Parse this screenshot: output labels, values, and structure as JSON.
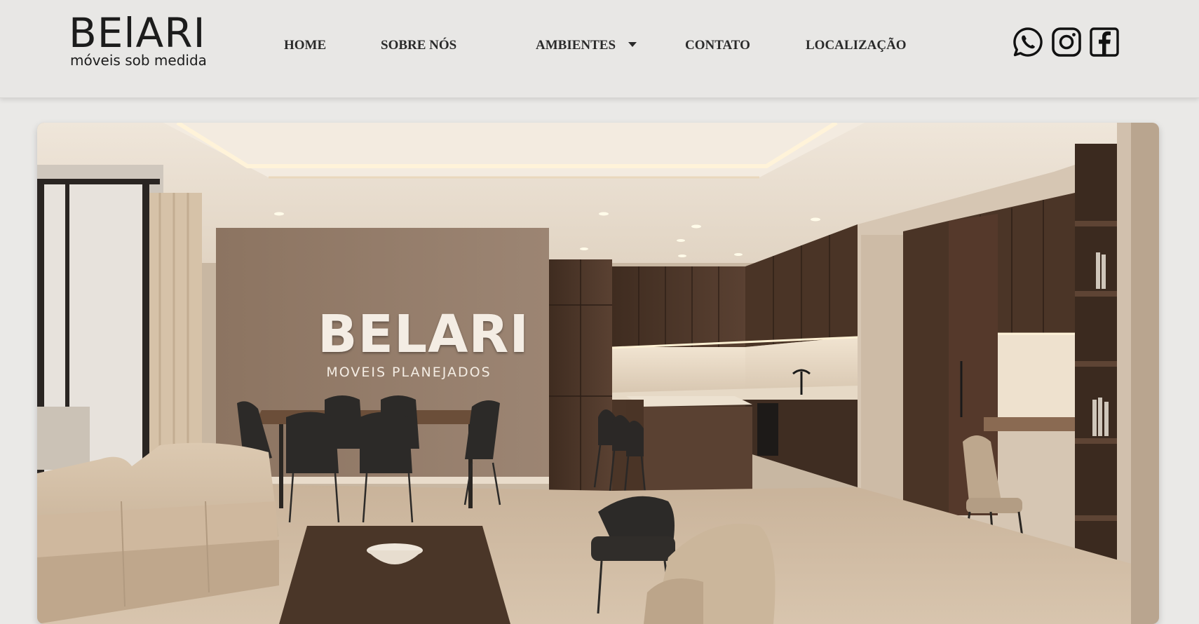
{
  "brand": {
    "logo_main": "BElARI",
    "logo_sub": "móveis sob medida"
  },
  "nav": {
    "home": "HOME",
    "sobre": "SOBRE NÓS",
    "ambientes": "AMBIENTES",
    "contato": "CONTATO",
    "localizacao": "LOCALIZAÇÃO"
  },
  "social": {
    "icons": [
      "whatsapp-icon",
      "instagram-icon",
      "facebook-icon"
    ]
  },
  "hero": {
    "title": "BELARI",
    "subtitle": "MOVEIS PLANEJADOS"
  },
  "colors": {
    "header_bg": "#e8e7e5",
    "page_bg": "#eae9e7",
    "nav_text": "#2a2a2a",
    "wood": "#4b3527"
  }
}
